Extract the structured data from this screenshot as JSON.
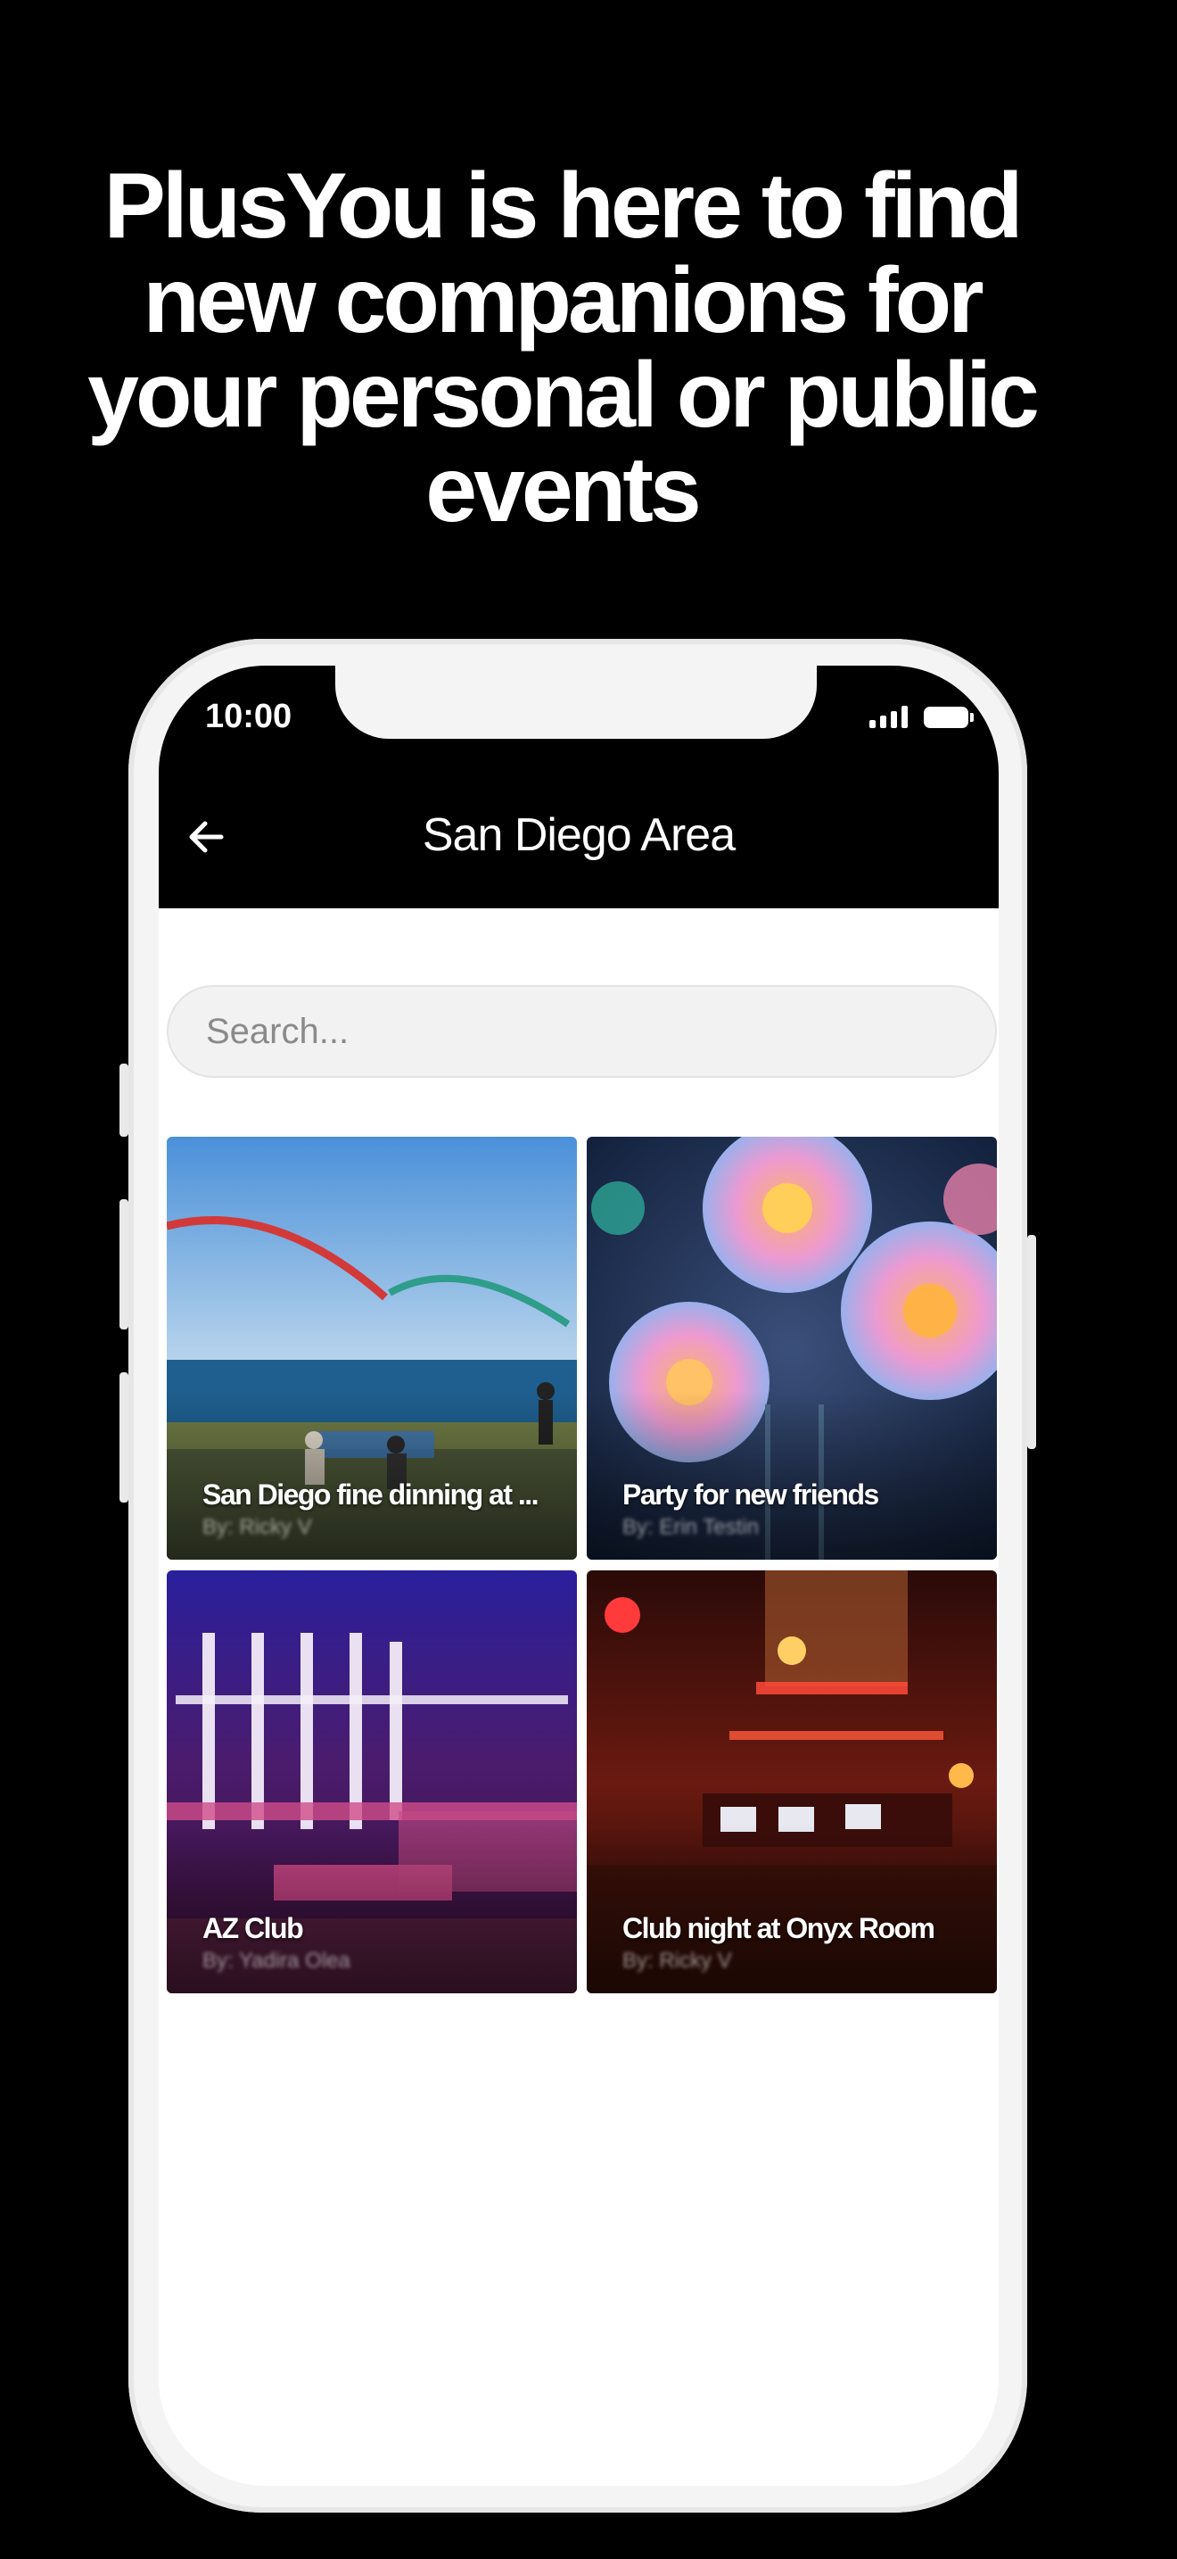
{
  "headline": "PlusYou is here to find new companions for your personal or public events",
  "status_bar": {
    "time": "10:00",
    "signal_icon": "signal-icon",
    "battery_icon": "battery-icon"
  },
  "nav": {
    "back_icon": "arrow-left-icon",
    "title": "San Diego Area"
  },
  "search": {
    "placeholder": "Search...",
    "value": ""
  },
  "events": [
    {
      "title": "San Diego fine dinning at ...",
      "author": "By: Ricky V"
    },
    {
      "title": "Party for new friends",
      "author": "By: Erin Testin"
    },
    {
      "title": "AZ Club",
      "author": "By: Yadira Olea"
    },
    {
      "title": "Club night at Onyx Room",
      "author": "By: Ricky V"
    }
  ],
  "colors": {
    "background": "#000000",
    "screen": "#ffffff",
    "nav_bar": "#000000",
    "phone_frame": "#f4f4f4"
  }
}
